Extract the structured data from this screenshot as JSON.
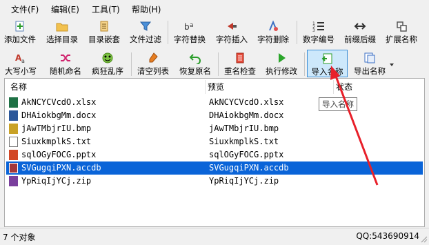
{
  "menu": [
    "文件(F)",
    "编辑(E)",
    "工具(T)",
    "帮助(H)"
  ],
  "toolbar1": [
    {
      "label": "添加文件",
      "icon": "add-file-icon"
    },
    {
      "label": "选择目录",
      "icon": "folder-icon"
    },
    {
      "label": "目录嵌套",
      "icon": "nested-folder-icon"
    },
    {
      "label": "文件过滤",
      "icon": "filter-icon"
    },
    {
      "label": "字符替换",
      "icon": "replace-chars-icon"
    },
    {
      "label": "字符插入",
      "icon": "insert-chars-icon"
    },
    {
      "label": "字符删除",
      "icon": "delete-chars-icon"
    },
    {
      "label": "数字编号",
      "icon": "numbering-icon"
    },
    {
      "label": "前缀后缀",
      "icon": "prefix-suffix-icon"
    },
    {
      "label": "扩展名称",
      "icon": "extension-icon"
    }
  ],
  "toolbar2": [
    {
      "label": "大写小写",
      "icon": "case-icon"
    },
    {
      "label": "随机命名",
      "icon": "shuffle-icon"
    },
    {
      "label": "疯狂乱序",
      "icon": "crazy-face-icon"
    },
    {
      "label": "清空列表",
      "icon": "clear-list-icon"
    },
    {
      "label": "恢复原名",
      "icon": "undo-icon"
    },
    {
      "label": "重名检查",
      "icon": "duplicate-check-icon"
    },
    {
      "label": "执行修改",
      "icon": "play-icon"
    },
    {
      "label": "导入名称",
      "icon": "import-names-icon"
    },
    {
      "label": "导出名称",
      "icon": "export-names-icon"
    }
  ],
  "columns": {
    "name": "名称",
    "preview": "预览",
    "status": "状态"
  },
  "files": [
    {
      "name": "AkNCYCVcdO.xlsx",
      "preview": "AkNCYCVcdO.xlsx",
      "icon": "excel-file-icon",
      "color": "#1e7145"
    },
    {
      "name": "DHAiokbgMm.docx",
      "preview": "DHAiokbgMm.docx",
      "icon": "word-file-icon",
      "color": "#2b579a"
    },
    {
      "name": "jAwTMbjrIU.bmp",
      "preview": "jAwTMbjrIU.bmp",
      "icon": "bmp-file-icon",
      "color": "#c9a227"
    },
    {
      "name": "SiuxkmplkS.txt",
      "preview": "SiuxkmplkS.txt",
      "icon": "text-file-icon",
      "color": "#777777"
    },
    {
      "name": "sqlOGyFOCG.pptx",
      "preview": "sqlOGyFOCG.pptx",
      "icon": "powerpoint-file-icon",
      "color": "#d24726"
    },
    {
      "name": "SVGugqiPXN.accdb",
      "preview": "SVGugqiPXN.accdb",
      "icon": "access-file-icon",
      "color": "#a4373a"
    },
    {
      "name": "YpRiqIjYCj.zip",
      "preview": "YpRiqIjYCj.zip",
      "icon": "zip-file-icon",
      "color": "#7a3f9d"
    }
  ],
  "selected_row": 5,
  "tooltip": "导入名称",
  "status": {
    "count": "7 个对象",
    "qq": "QQ:543690914"
  },
  "colors": {
    "selection": "#0a64d8",
    "annotation_arrow": "#e8202a",
    "active_button": "#cde8fb"
  }
}
